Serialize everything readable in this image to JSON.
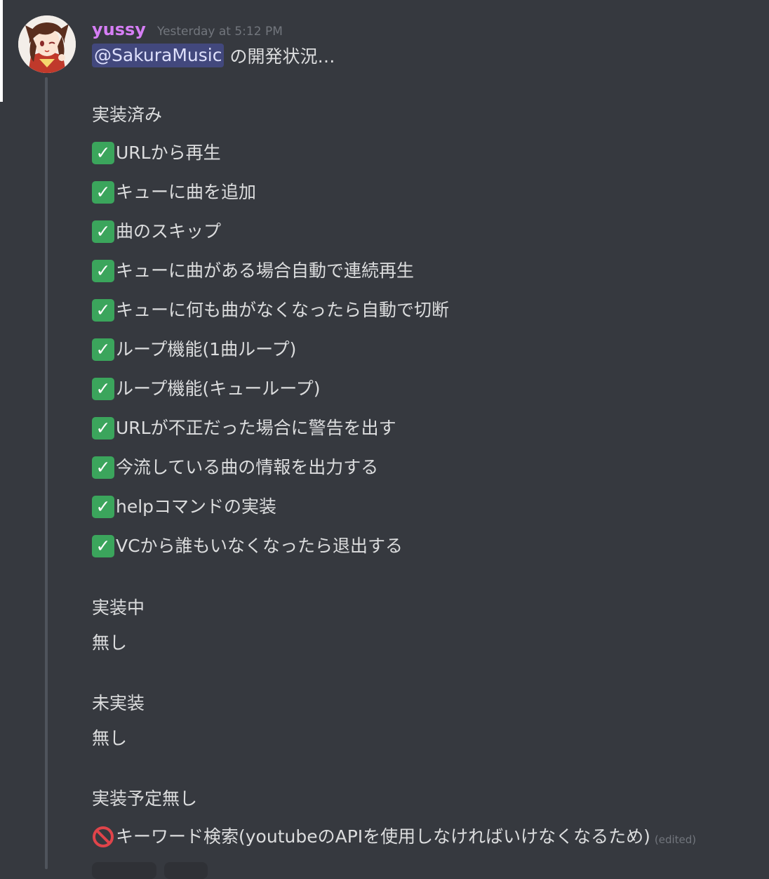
{
  "message": {
    "username": "yussy",
    "timestamp": "Yesterday at 5:12 PM",
    "mention": "@SakuraMusic",
    "intro": "の開発状況…",
    "sections": {
      "implemented": {
        "heading": "実装済み",
        "items": [
          "URLから再生",
          "キューに曲を追加",
          "曲のスキップ",
          "キューに曲がある場合自動で連続再生",
          "キューに何も曲がなくなったら自動で切断",
          "ループ機能(1曲ループ)",
          "ループ機能(キューループ)",
          "URLが不正だった場合に警告を出す",
          "今流している曲の情報を出力する",
          "helpコマンドの実装",
          "VCから誰もいなくなったら退出する"
        ]
      },
      "in_progress": {
        "heading": "実装中",
        "value": "無し"
      },
      "not_implemented": {
        "heading": "未実装",
        "value": "無し"
      },
      "no_plan": {
        "heading": "実装予定無し",
        "item": "キーワード検索(youtubeのAPIを使用しなければいけなくなるため)",
        "edited": "(edited)"
      }
    }
  },
  "icons": {
    "check": "white-heavy-check-mark-icon",
    "prohibit": "no-entry-sign-icon"
  },
  "colors": {
    "background": "#36393f",
    "username": "#d67ef5",
    "mention_bg": "#505796",
    "check": "#3ba55c",
    "prohibit": "#e0444a"
  }
}
